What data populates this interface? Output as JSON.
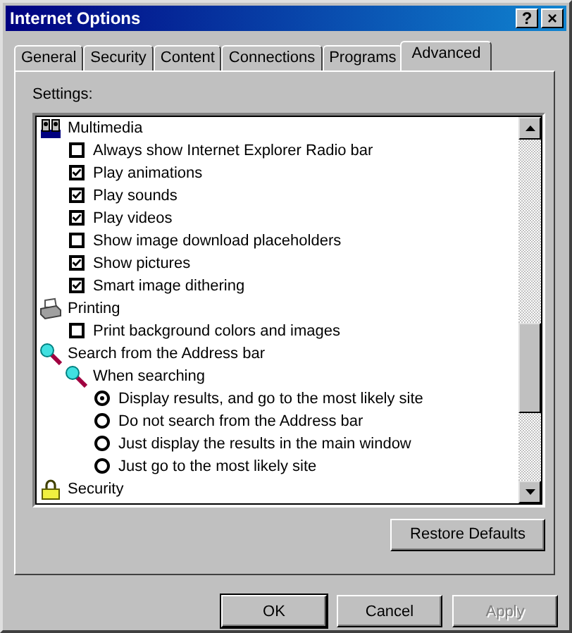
{
  "window": {
    "title": "Internet Options",
    "help_button": "?",
    "close_button": "×"
  },
  "tabs": [
    {
      "label": "General",
      "selected": false
    },
    {
      "label": "Security",
      "selected": false
    },
    {
      "label": "Content",
      "selected": false
    },
    {
      "label": "Connections",
      "selected": false
    },
    {
      "label": "Programs",
      "selected": false
    },
    {
      "label": "Advanced",
      "selected": true
    }
  ],
  "settings_label": "Settings:",
  "settings": [
    {
      "kind": "group",
      "label": "Multimedia",
      "children": [
        {
          "kind": "checkbox",
          "label": "Always show Internet Explorer Radio bar",
          "checked": false
        },
        {
          "kind": "checkbox",
          "label": "Play animations",
          "checked": true
        },
        {
          "kind": "checkbox",
          "label": "Play sounds",
          "checked": true
        },
        {
          "kind": "checkbox",
          "label": "Play videos",
          "checked": true
        },
        {
          "kind": "checkbox",
          "label": "Show image download placeholders",
          "checked": false
        },
        {
          "kind": "checkbox",
          "label": "Show pictures",
          "checked": true
        },
        {
          "kind": "checkbox",
          "label": "Smart image dithering",
          "checked": true
        }
      ]
    },
    {
      "kind": "group",
      "label": "Printing",
      "children": [
        {
          "kind": "checkbox",
          "label": "Print background colors and images",
          "checked": false
        }
      ]
    },
    {
      "kind": "group",
      "label": "Search from the Address bar",
      "children": [
        {
          "kind": "group",
          "label": "When searching",
          "children": [
            {
              "kind": "radio",
              "label": "Display results, and go to the most likely site",
              "selected": true
            },
            {
              "kind": "radio",
              "label": "Do not search from the Address bar",
              "selected": false
            },
            {
              "kind": "radio",
              "label": "Just display the results in the main window",
              "selected": false
            },
            {
              "kind": "radio",
              "label": "Just go to the most likely site",
              "selected": false
            }
          ]
        }
      ]
    },
    {
      "kind": "group",
      "label": "Security"
    }
  ],
  "restore_button": "Restore Defaults",
  "buttons": [
    {
      "label": "OK",
      "default": true,
      "disabled": false
    },
    {
      "label": "Cancel",
      "default": false,
      "disabled": false
    },
    {
      "label": "Apply",
      "default": false,
      "disabled": true
    }
  ]
}
